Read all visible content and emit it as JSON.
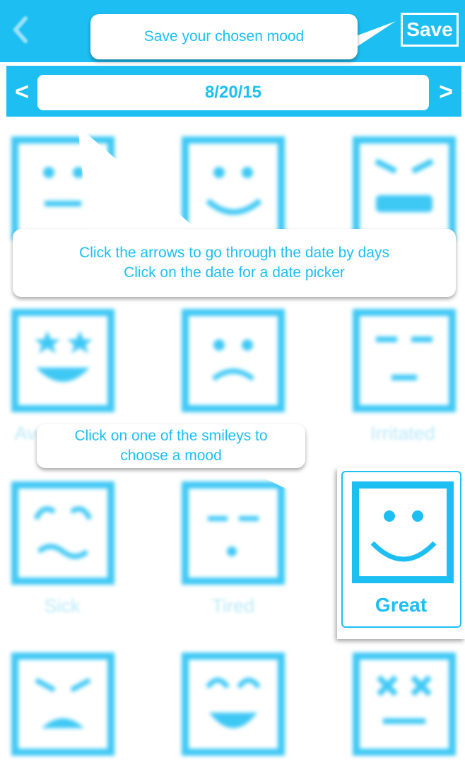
{
  "header": {
    "back_icon": "chevron-left-icon",
    "save_label": "Save"
  },
  "date_nav": {
    "prev_label": "<",
    "date": "8/20/15",
    "next_label": ">"
  },
  "tooltips": {
    "save": "Save your chosen mood",
    "date_line1": "Click the arrows to go through the date by days",
    "date_line2": "Click on the date for a date picker",
    "smiley_line1": "Click on one of the smileys to",
    "smiley_line2": "choose a mood"
  },
  "moods": {
    "row2_left_label": "Av",
    "row2_right_label": "Irritated",
    "row3_left_label": "Sick",
    "row3_mid_label": "Tired",
    "highlighted_label": "Great"
  },
  "colors": {
    "accent": "#1dbff3",
    "faded_label": "#b9e9f9",
    "background": "#ffffff"
  }
}
